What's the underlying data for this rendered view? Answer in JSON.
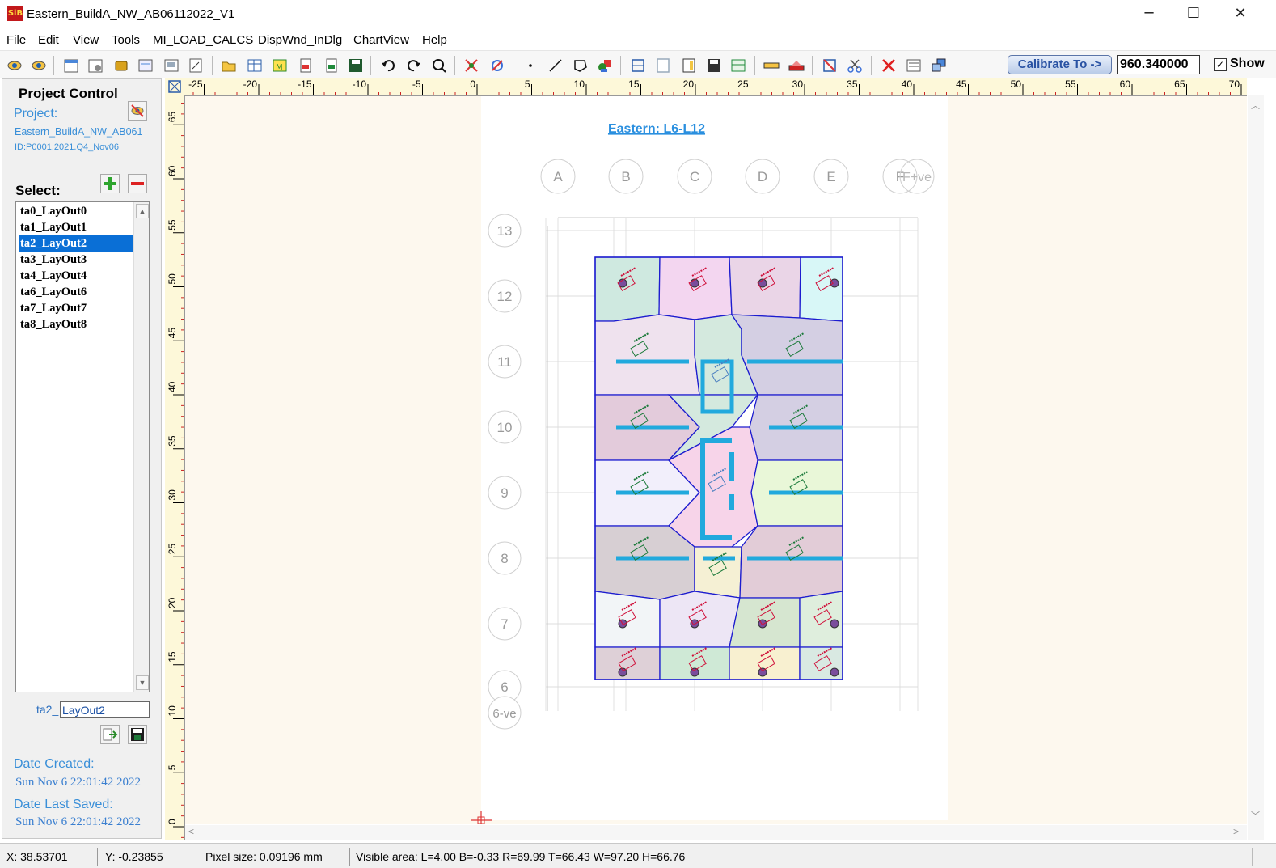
{
  "window": {
    "title": "Eastern_BuildA_NW_AB06112022_V1",
    "logo_text": "SiB",
    "minimize": "─",
    "maximize": "☐",
    "close": "✕"
  },
  "menu": [
    "File",
    "Edit",
    "View",
    "Tools",
    "MI_LOAD_CALCS",
    "DispWnd_InDlg",
    "ChartView",
    "Help"
  ],
  "toolbar": {
    "calibrate_label": "Calibrate To ->",
    "calibrate_value": "960.340000",
    "show_label": "Show",
    "show_checked": "✓"
  },
  "project_control": {
    "title": "Project Control",
    "project_label": "Project:",
    "project_name": "Eastern_BuildA_NW_AB061",
    "project_id": "ID:P0001.2021.Q4_Nov06",
    "select_label": "Select:",
    "layouts": [
      "ta0_LayOut0",
      "ta1_LayOut1",
      "ta2_LayOut2",
      "ta3_LayOut3",
      "ta4_LayOut4",
      "ta6_LayOut6",
      "ta7_LayOut7",
      "ta8_LayOut8"
    ],
    "selected_layout": "ta2_LayOut2",
    "name_prefix": "ta2_",
    "name_value": "LayOut2",
    "date_created_label": "Date Created:",
    "date_created": "Sun Nov  6 22:01:42 2022",
    "date_saved_label": "Date Last Saved:",
    "date_saved": "Sun Nov  6 22:01:42 2022"
  },
  "ruler": {
    "top_labels": [
      "-25",
      "-20",
      "-15",
      "-10",
      "-5",
      "0",
      "5",
      "10",
      "15",
      "20",
      "25",
      "30",
      "35",
      "40",
      "45",
      "50",
      "55",
      "60",
      "65",
      "70"
    ],
    "left_labels": [
      "65",
      "60",
      "55",
      "50",
      "45",
      "40",
      "35",
      "30",
      "25",
      "20",
      "15",
      "10",
      "5",
      "0"
    ]
  },
  "drawing": {
    "title": "Eastern: L6-L12",
    "col_labels": [
      "A",
      "B",
      "C",
      "D",
      "E",
      "F",
      "F+ve"
    ],
    "row_labels": [
      "13",
      "12",
      "11",
      "10",
      "9",
      "8",
      "7",
      "6",
      "6-ve"
    ],
    "colors": {
      "border": "#1c1ccf",
      "column": "#21a9dd",
      "red_text": "#d0103a",
      "green_text": "#1b7a3a",
      "accent": "#2952a3"
    }
  },
  "status": {
    "x": "X: 38.53701",
    "y": "Y: -0.23855",
    "pixel": "Pixel size: 0.09196 mm",
    "visible": "Visible area:  L=4.00  B=-0.33  R=69.99  T=66.43   W=97.20  H=66.76"
  }
}
